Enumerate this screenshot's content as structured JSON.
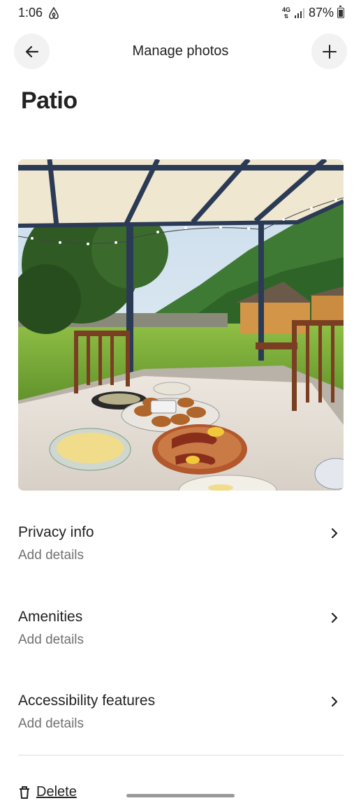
{
  "status_bar": {
    "time": "1:06",
    "network": "4G",
    "battery": "87%",
    "app_icon": "airbnb-logo-icon"
  },
  "header": {
    "title": "Manage photos",
    "back_icon": "arrow-left-icon",
    "add_icon": "plus-icon"
  },
  "room": {
    "name": "Patio"
  },
  "photo": {
    "subject": "patio"
  },
  "detail_rows": [
    {
      "title": "Privacy info",
      "subtitle": "Add details"
    },
    {
      "title": "Amenities",
      "subtitle": "Add details"
    },
    {
      "title": "Accessibility features",
      "subtitle": "Add details"
    }
  ],
  "delete": {
    "label": "Delete",
    "icon": "trash-icon"
  },
  "colors": {
    "text": "#222222",
    "muted": "#717171",
    "button_bg": "#f2f2f2",
    "divider": "#dddddd"
  }
}
